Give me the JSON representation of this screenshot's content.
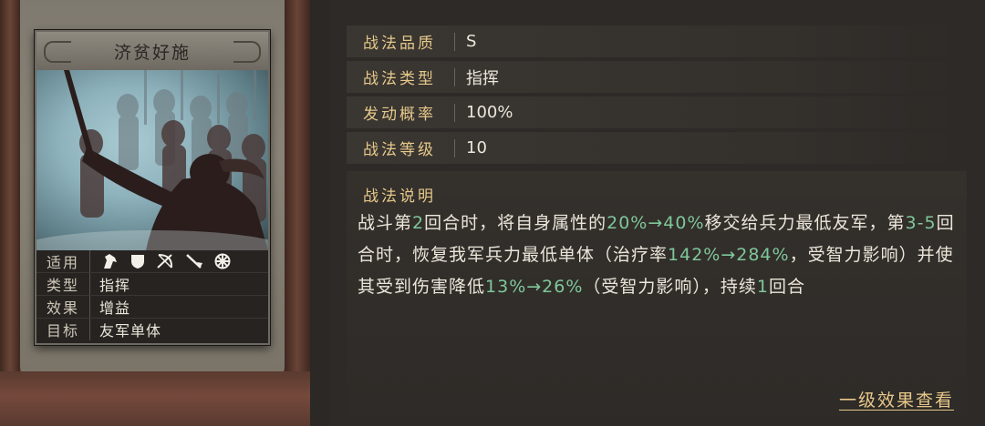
{
  "card": {
    "title": "济贫好施",
    "rows": [
      {
        "label": "适用",
        "icons": [
          "cavalry-icon",
          "shield-icon",
          "bow-icon",
          "spear-icon",
          "chariot-wheel-icon"
        ]
      },
      {
        "label": "类型",
        "value": "指挥"
      },
      {
        "label": "效果",
        "value": "增益"
      },
      {
        "label": "目标",
        "value": "友军单体"
      }
    ]
  },
  "attributes": [
    {
      "key": "战法品质",
      "value": "S"
    },
    {
      "key": "战法类型",
      "value": "指挥"
    },
    {
      "key": "发动概率",
      "value": "100%"
    },
    {
      "key": "战法等级",
      "value": "10"
    }
  ],
  "description": {
    "title": "战法说明",
    "segments": [
      {
        "t": "战斗第",
        "c": "w"
      },
      {
        "t": "2",
        "c": "g"
      },
      {
        "t": "回合时，将自身属性的",
        "c": "w"
      },
      {
        "t": "20%→40%",
        "c": "g"
      },
      {
        "t": "移交给兵力最低友军，第",
        "c": "w"
      },
      {
        "t": "3-5",
        "c": "g"
      },
      {
        "t": "回合时，恢复我军兵力最低单体（治疗率",
        "c": "w"
      },
      {
        "t": "142%→284%",
        "c": "g"
      },
      {
        "t": "，受智力影响）并使其受到伤害降低",
        "c": "w"
      },
      {
        "t": "13%→26%",
        "c": "g"
      },
      {
        "t": "（受智力影响），持续",
        "c": "w"
      },
      {
        "t": "1",
        "c": "g"
      },
      {
        "t": "回合",
        "c": "w"
      }
    ]
  },
  "more_link": "一级效果查看",
  "colors": {
    "accent_gold": "#e6c98a",
    "value_green": "#7fc79b",
    "text": "#ece6da"
  }
}
